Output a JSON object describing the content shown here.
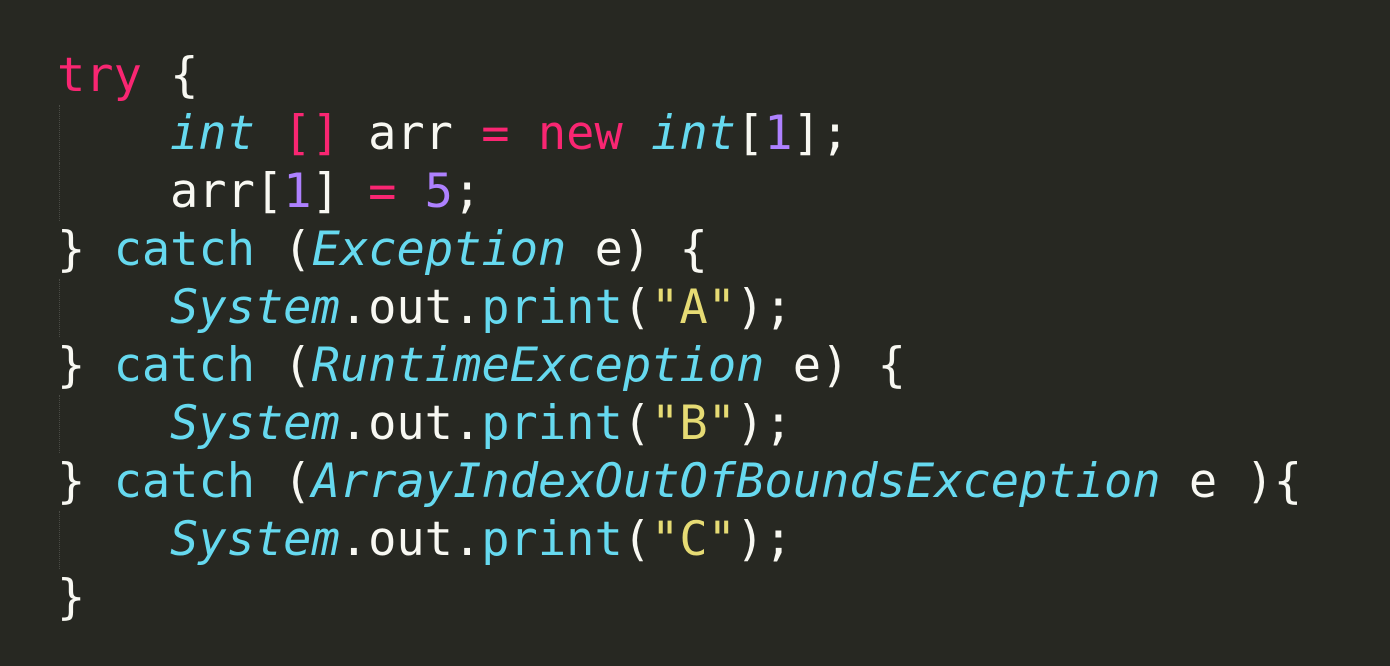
{
  "editor": {
    "background": "#272822",
    "theme_colors": {
      "keyword": "#f92672",
      "type": "#66d9ef",
      "function": "#66d9ef",
      "number": "#ae81ff",
      "string": "#e6db74",
      "plain": "#f8f8f2"
    },
    "lines": [
      {
        "indent": 0,
        "tokens": [
          {
            "t": "try",
            "c": "kw"
          },
          {
            "t": " {",
            "c": "plain"
          }
        ]
      },
      {
        "indent": 1,
        "tokens": [
          {
            "t": "int",
            "c": "type"
          },
          {
            "t": " ",
            "c": "plain"
          },
          {
            "t": "[]",
            "c": "kw"
          },
          {
            "t": " arr ",
            "c": "plain"
          },
          {
            "t": "=",
            "c": "kw"
          },
          {
            "t": " ",
            "c": "plain"
          },
          {
            "t": "new",
            "c": "kw"
          },
          {
            "t": " ",
            "c": "plain"
          },
          {
            "t": "int",
            "c": "type"
          },
          {
            "t": "[",
            "c": "plain"
          },
          {
            "t": "1",
            "c": "num"
          },
          {
            "t": "];",
            "c": "plain"
          }
        ]
      },
      {
        "indent": 1,
        "tokens": [
          {
            "t": "arr[",
            "c": "plain"
          },
          {
            "t": "1",
            "c": "num"
          },
          {
            "t": "] ",
            "c": "plain"
          },
          {
            "t": "=",
            "c": "kw"
          },
          {
            "t": " ",
            "c": "plain"
          },
          {
            "t": "5",
            "c": "num"
          },
          {
            "t": ";",
            "c": "plain"
          }
        ]
      },
      {
        "indent": 0,
        "tokens": [
          {
            "t": "} ",
            "c": "plain"
          },
          {
            "t": "catch",
            "c": "fn"
          },
          {
            "t": " (",
            "c": "plain"
          },
          {
            "t": "Exception",
            "c": "type"
          },
          {
            "t": " e) {",
            "c": "plain"
          }
        ]
      },
      {
        "indent": 1,
        "tokens": [
          {
            "t": "System",
            "c": "type"
          },
          {
            "t": ".out.",
            "c": "plain"
          },
          {
            "t": "print",
            "c": "fn"
          },
          {
            "t": "(",
            "c": "plain"
          },
          {
            "t": "\"A\"",
            "c": "str"
          },
          {
            "t": ");",
            "c": "plain"
          }
        ]
      },
      {
        "indent": 0,
        "tokens": [
          {
            "t": "} ",
            "c": "plain"
          },
          {
            "t": "catch",
            "c": "fn"
          },
          {
            "t": " (",
            "c": "plain"
          },
          {
            "t": "RuntimeException",
            "c": "type"
          },
          {
            "t": " e) {",
            "c": "plain"
          }
        ]
      },
      {
        "indent": 1,
        "tokens": [
          {
            "t": "System",
            "c": "type"
          },
          {
            "t": ".out.",
            "c": "plain"
          },
          {
            "t": "print",
            "c": "fn"
          },
          {
            "t": "(",
            "c": "plain"
          },
          {
            "t": "\"B\"",
            "c": "str"
          },
          {
            "t": ");",
            "c": "plain"
          }
        ]
      },
      {
        "indent": 0,
        "tokens": [
          {
            "t": "} ",
            "c": "plain"
          },
          {
            "t": "catch",
            "c": "fn"
          },
          {
            "t": " (",
            "c": "plain"
          },
          {
            "t": "ArrayIndexOutOfBoundsException",
            "c": "type"
          },
          {
            "t": " e ){",
            "c": "plain"
          }
        ]
      },
      {
        "indent": 1,
        "tokens": [
          {
            "t": "System",
            "c": "type"
          },
          {
            "t": ".out.",
            "c": "plain"
          },
          {
            "t": "print",
            "c": "fn"
          },
          {
            "t": "(",
            "c": "plain"
          },
          {
            "t": "\"C\"",
            "c": "str"
          },
          {
            "t": ");",
            "c": "plain"
          }
        ]
      },
      {
        "indent": 0,
        "tokens": [
          {
            "t": "}",
            "c": "plain"
          }
        ]
      }
    ]
  }
}
